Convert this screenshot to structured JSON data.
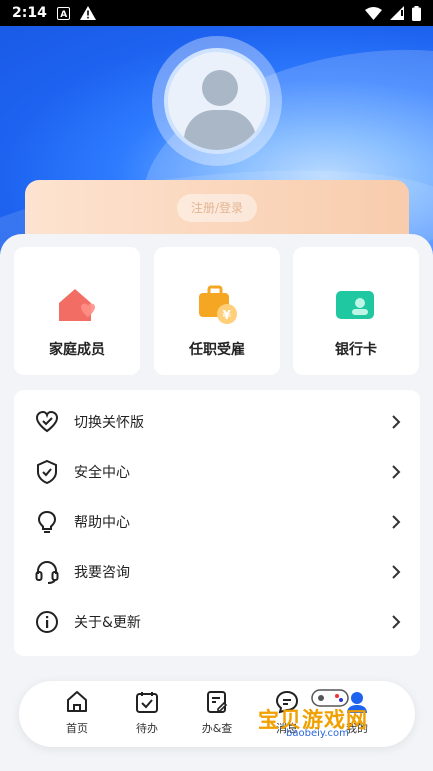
{
  "status_bar": {
    "time": "2:14"
  },
  "profile": {
    "login_label": "注册/登录"
  },
  "quick_actions": [
    {
      "label": "家庭成员",
      "icon": "home-heart-icon",
      "color": "#f0554a"
    },
    {
      "label": "任职受雇",
      "icon": "briefcase-icon",
      "color": "#f5a623"
    },
    {
      "label": "银行卡",
      "icon": "bank-card-icon",
      "color": "#1fc8a0"
    }
  ],
  "menu": [
    {
      "label": "切换关怀版",
      "icon": "heart-icon"
    },
    {
      "label": "安全中心",
      "icon": "shield-icon"
    },
    {
      "label": "帮助中心",
      "icon": "lightbulb-icon"
    },
    {
      "label": "我要咨询",
      "icon": "headset-icon"
    },
    {
      "label": "关于&更新",
      "icon": "info-icon"
    }
  ],
  "bottom_nav": [
    {
      "label": "首页",
      "icon": "home-icon"
    },
    {
      "label": "待办",
      "icon": "calendar-check-icon"
    },
    {
      "label": "办&查",
      "icon": "document-edit-icon"
    },
    {
      "label": "消息",
      "icon": "message-icon"
    },
    {
      "label": "我的",
      "icon": "user-icon"
    }
  ],
  "watermark": {
    "title": "宝贝游戏网",
    "url": "baobeiy.com"
  },
  "colors": {
    "accent": "#1d63f0",
    "login_card": "#f8ccac"
  }
}
